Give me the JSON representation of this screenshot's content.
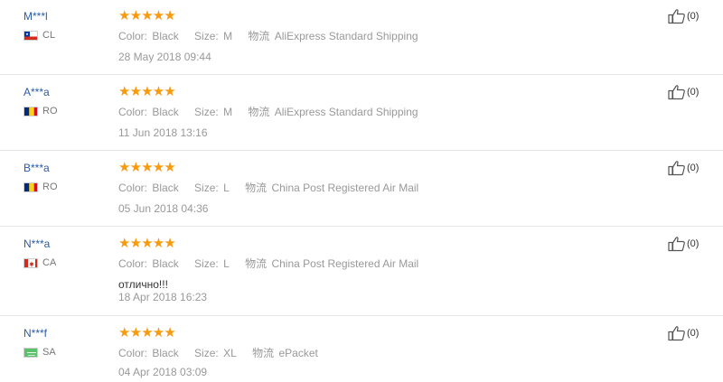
{
  "labels": {
    "color": "Color:",
    "size": "Size:",
    "logistics": "物流"
  },
  "reviews": [
    {
      "user": "M***l",
      "country": "CL",
      "flag": "cl",
      "stars": 5,
      "color": "Black",
      "size": "M",
      "shipping": "AliExpress Standard Shipping",
      "feedback": "",
      "date": "28 May 2018 09:44",
      "helpful": "(0)"
    },
    {
      "user": "A***a",
      "country": "RO",
      "flag": "ro",
      "stars": 5,
      "color": "Black",
      "size": "M",
      "shipping": "AliExpress Standard Shipping",
      "feedback": "",
      "date": "11 Jun 2018 13:16",
      "helpful": "(0)"
    },
    {
      "user": "B***a",
      "country": "RO",
      "flag": "ro",
      "stars": 5,
      "color": "Black",
      "size": "L",
      "shipping": "China Post Registered Air Mail",
      "feedback": "",
      "date": "05 Jun 2018 04:36",
      "helpful": "(0)"
    },
    {
      "user": "N***a",
      "country": "CA",
      "flag": "ca",
      "stars": 5,
      "color": "Black",
      "size": "L",
      "shipping": "China Post Registered Air Mail",
      "feedback": "отлично!!!",
      "date": "18 Apr 2018 16:23",
      "helpful": "(0)"
    },
    {
      "user": "N***f",
      "country": "SA",
      "flag": "sa",
      "stars": 5,
      "color": "Black",
      "size": "XL",
      "shipping": "ePacket",
      "feedback": "",
      "date": "04 Apr 2018 03:09",
      "helpful": "(0)"
    }
  ],
  "colors": {
    "star": "#f79a0e",
    "username": "#2a5ba8",
    "divider": "#e5e5e5"
  }
}
